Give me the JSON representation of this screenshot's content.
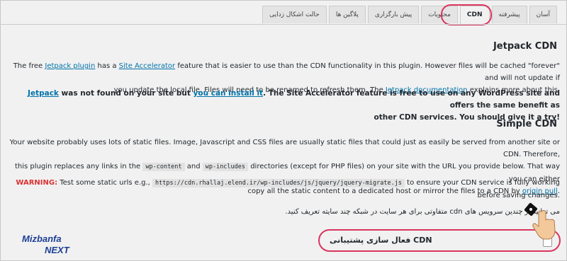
{
  "tabs": [
    {
      "label": "آسان",
      "active": false
    },
    {
      "label": "پیشرفته",
      "active": false
    },
    {
      "label": "CDN",
      "active": true
    },
    {
      "label": "محتویات",
      "active": false
    },
    {
      "label": "پیش بارگزاری",
      "active": false
    },
    {
      "label": "پلاگین ها",
      "active": false
    },
    {
      "label": "حالت اشکال زدایی",
      "active": false
    }
  ],
  "jetpack": {
    "title": "Jetpack CDN",
    "p1_a": "The free ",
    "p1_link1": "Jetpack plugin",
    "p1_b": " has a ",
    "p1_link2": "Site Accelerator",
    "p1_c": " feature that is easier to use than the CDN functionality in this plugin. However files will be cached \"forever\" and will not update if",
    "p1_d": "you update the local file. Files will need to be renamed to refresh them. The ",
    "p1_link3": "Jetpack documentation",
    "p1_e": " explains more about this.",
    "p2_link1": "Jetpack",
    "p2_a": " was not found on your site but ",
    "p2_link2": "you can install it",
    "p2_b": ". The Site Accelerator feature is free to use on any WordPress site and offers the same benefit as",
    "p2_c": "other CDN services. You should give it a try!"
  },
  "simple": {
    "title": "Simple CDN",
    "p1_a": "Your website probably uses lots of static files. Image, Javascript and CSS files are usually static files that could just as easily be served from another site or CDN. Therefore,",
    "p1_b": "this plugin replaces any links in the ",
    "code1": "wp-content",
    "p1_c": " and ",
    "code2": "wp-includes",
    "p1_d": " directories (except for PHP files) on your site with the URL you provide below. That way you can either",
    "p1_e": "copy all the static content to a dedicated host or mirror the files to a CDN by ",
    "p1_link": "origin pull",
    "p1_f": ".",
    "warning_label": "WARNING:",
    "warning_a": " Test some static urls e.g., ",
    "warning_code": "https://cdn.rhallaj.elend.ir/wp-includes/js/jquery/jquery-migrate.js",
    "warning_b": " to ensure your CDN service is fully working",
    "warning_c": "before saving changes.",
    "persian_note": "می توانید از چندین سرویس های cdn متفاوتی برای هر سایت در شبکه چند سایته تعریف کنید."
  },
  "cdn_toggle": {
    "label": "فعال سازی پشتیبانی CDN",
    "checked": false
  },
  "logo": {
    "top": "Mizbanfa",
    "bottom": "NEXT"
  },
  "colors": {
    "highlight": "#d9345e",
    "link": "#0073aa",
    "warning": "#dc3232"
  }
}
